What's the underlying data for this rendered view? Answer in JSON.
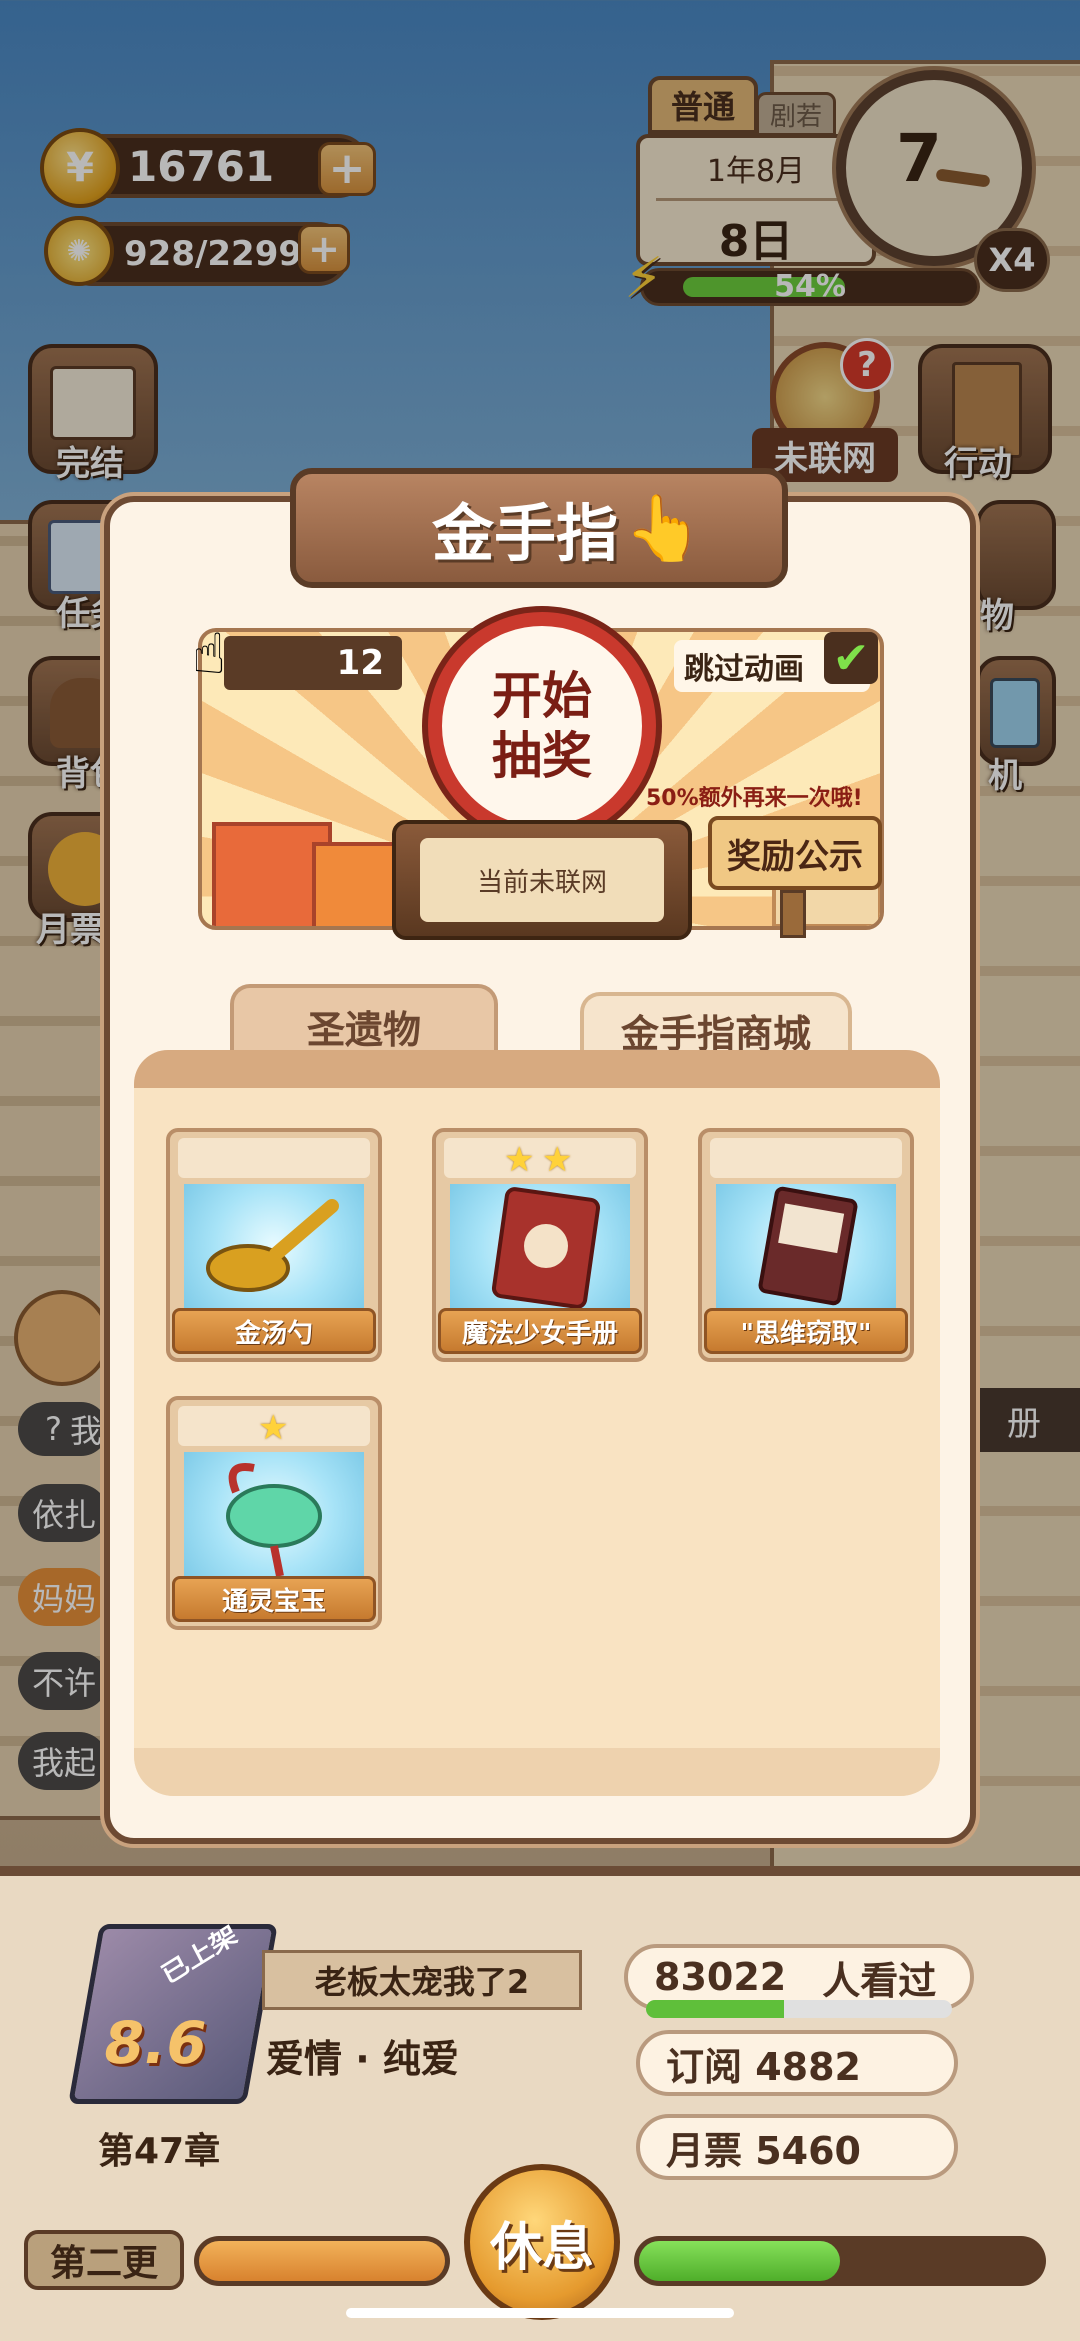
{
  "hud": {
    "coins": "16761",
    "energy": "928/2299",
    "mode_tab": "普通",
    "mode_tab2": "剧若",
    "date_month": "1年8月",
    "date_day": "8日",
    "clock_hour": "7",
    "speed": "X4",
    "progress_label": "54%",
    "progress_value": 0.54
  },
  "side_left": [
    {
      "label": "完结",
      "icon": "book-icon"
    },
    {
      "label": "任务",
      "icon": "notebook-icon"
    },
    {
      "label": "背包",
      "icon": "bag-icon"
    },
    {
      "label": "月票",
      "icon": "ticket-icon"
    }
  ],
  "side_right": [
    {
      "label": "未联网",
      "icon": "wheel-icon",
      "badge": "?"
    },
    {
      "label": "行动",
      "icon": "door-icon"
    },
    {
      "label": "物",
      "icon": "shop-icon"
    },
    {
      "label": "机",
      "icon": "phone-icon"
    }
  ],
  "side_bubbles": [
    "我",
    "依扎",
    "妈妈",
    "不许",
    "我起"
  ],
  "side_right_chip": "册",
  "modal": {
    "title": "金手指",
    "finger_count": "12",
    "skip_label": "跳过动画",
    "draw_button": "开始\n抽奖",
    "status": "当前未联网",
    "bonus_text": "50%额外再来一次哦!",
    "rewards_button": "奖励公示",
    "tabs": [
      "圣遗物",
      "金手指商城"
    ],
    "items": [
      {
        "name": "金汤勺",
        "stars": 0,
        "icon": "spoon-icon"
      },
      {
        "name": "魔法少女手册",
        "stars": 2,
        "icon": "magic-book-icon"
      },
      {
        "name": "\"思维窃取\"",
        "stars": 0,
        "icon": "card-icon"
      },
      {
        "name": "通灵宝玉",
        "stars": 1,
        "icon": "jade-icon"
      }
    ]
  },
  "book": {
    "shelf_tag": "已上架",
    "rating": "8.6",
    "title": "老板太宠我了2",
    "genre": "爱情 · 纯爱",
    "chapter": "第47章",
    "views": "83022",
    "views_label": "人看过",
    "views_progress": 0.45,
    "subscribe": "订阅 4882",
    "monthly": "月票 5460"
  },
  "footer": {
    "update": "第二更",
    "rest": "休息",
    "left_bar": 1.0,
    "right_bar": 0.5
  },
  "colors": {
    "modal_bg": "#fdf3e6",
    "frame": "#6d4a33",
    "accent_red": "#c9392d",
    "progress_green": "#5fbf3a"
  }
}
